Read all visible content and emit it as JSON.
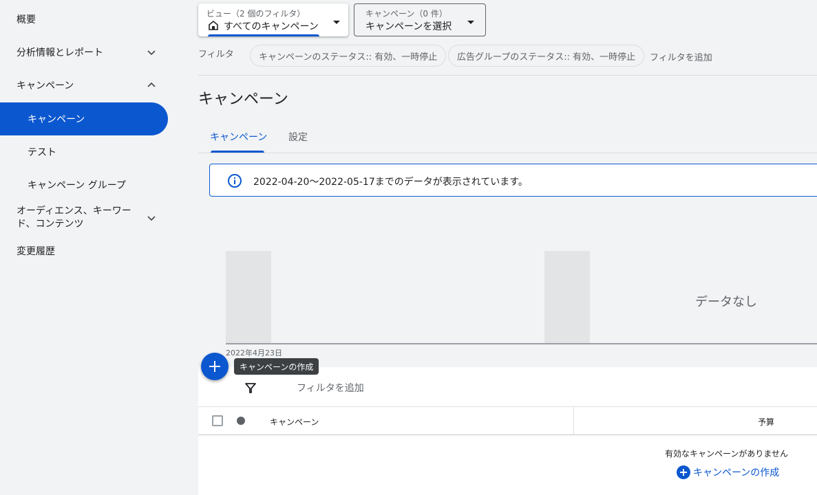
{
  "sidebar": {
    "items": [
      {
        "label": "概要"
      },
      {
        "label": "分析情報とレポート"
      },
      {
        "label": "キャンペーン"
      },
      {
        "label": "キャンペーン"
      },
      {
        "label": "テスト"
      },
      {
        "label": "キャンペーン グループ"
      },
      {
        "label": "オーディエンス、キーワー"
      },
      {
        "label": "ド、コンテンツ"
      },
      {
        "label": "変更履歴"
      }
    ]
  },
  "header": {
    "view_caption": "ビュー（2 個のフィルタ）",
    "view_value": "すべてのキャンペーン",
    "campaign_caption": "キャンペーン（0 件）",
    "campaign_value": "キャンペーンを選択"
  },
  "filters": {
    "label": "フィルタ",
    "chips": [
      "キャンペーンのステータス:: 有効、一時停止",
      "広告グループのステータス:: 有効、一時停止"
    ],
    "add": "フィルタを追加"
  },
  "page": {
    "title": "キャンペーン",
    "tabs": [
      "キャンペーン",
      "設定"
    ],
    "info_text": "2022-04-20〜2022-05-17までのデータが表示されています。"
  },
  "chart_data": {
    "type": "bar",
    "x_tick": "2022年4月23日",
    "no_data_label": "データなし"
  },
  "fab": {
    "tooltip": "キャンペーンの作成"
  },
  "table": {
    "filter_text": "フィルタを追加",
    "columns": [
      "キャンペーン",
      "予算"
    ],
    "empty_message": "有効なキャンペーンがありません",
    "create_link": "キャンペーンの作成"
  },
  "colors": {
    "accent": "#0b57d0",
    "background": "#f1f3f4"
  }
}
